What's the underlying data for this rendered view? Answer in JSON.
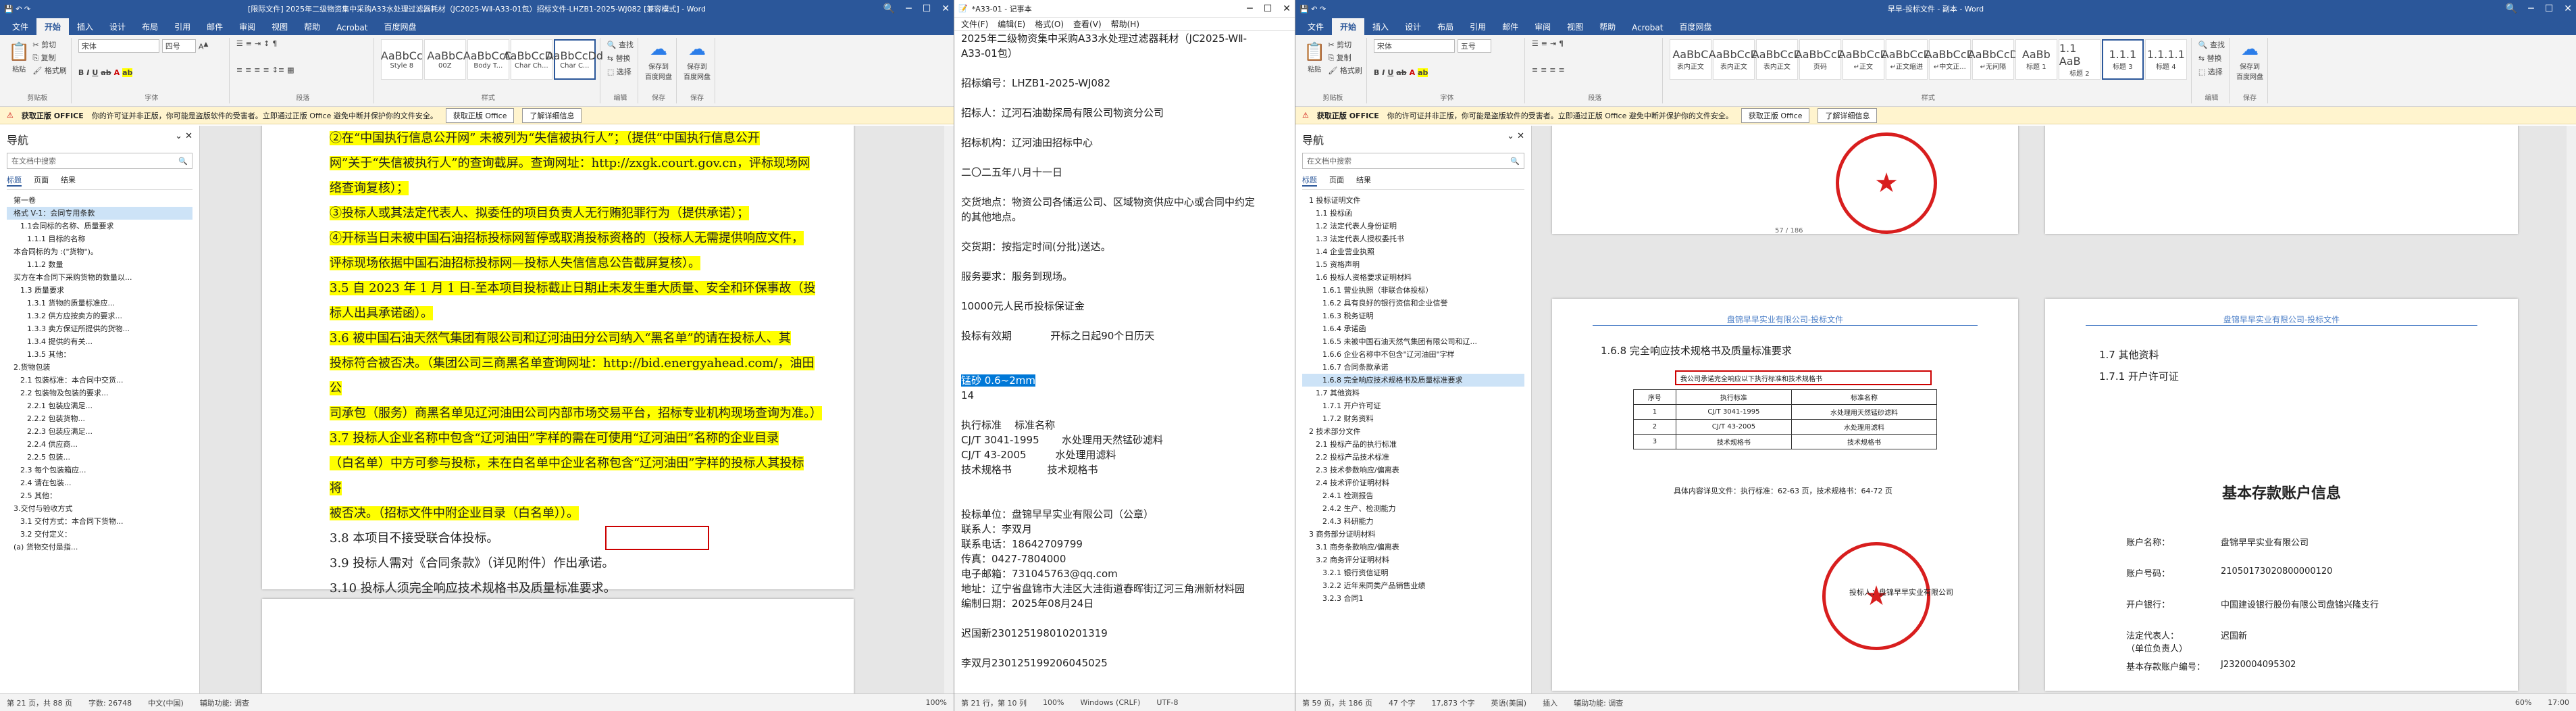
{
  "win1": {
    "title": "[限际文件] 2025年二级物资集中采购A33水处理过滤器耗材（JC2025-WⅡ-A33-01包）招标文件-LHZB1-2025-WJ082 [兼容模式] - Word",
    "tabs": [
      "文件",
      "开始",
      "插入",
      "设计",
      "布局",
      "引用",
      "邮件",
      "审阅",
      "视图",
      "帮助",
      "Acrobat",
      "百度网盘"
    ],
    "active_tab": "开始",
    "font_name": "宋体",
    "font_size": "四号",
    "styles": [
      {
        "preview": "AaBbCc",
        "name": "Style 8"
      },
      {
        "preview": "AaBbC",
        "name": "00Z"
      },
      {
        "preview": "AaBbCcD",
        "name": "Body T..."
      },
      {
        "preview": "AaBbCcDd",
        "name": "Char Ch..."
      },
      {
        "preview": "AaBbCcDd",
        "name": "Char C..."
      }
    ],
    "groups": [
      "剪贴板",
      "字体",
      "段落",
      "样式",
      "编辑",
      "保存",
      "保存"
    ],
    "clipboard": {
      "paste": "粘贴",
      "cut": "剪切",
      "copy": "复制",
      "format": "格式刷"
    },
    "edit": {
      "find": "查找",
      "replace": "替换",
      "select": "选择"
    },
    "save_button": "保存到\n百度网盘",
    "msg": {
      "label": "获取正版 OFFICE",
      "text": "你的许可证并非正版，你可能是盗版软件的受害者。立即通过正版 Office 避免中断并保护你的文件安全。",
      "b1": "获取正版 Office",
      "b2": "了解详细信息"
    },
    "nav": {
      "title": "导航",
      "search_placeholder": "在文档中搜索",
      "tabs": [
        "标题",
        "页面",
        "结果"
      ],
      "items": [
        "第一卷",
        "格式 V-1：会同专用条款",
        "1.1会同标的名称、质量要求",
        "1.1.1 目标的名称",
        "本合同标的为 :(\"货物\")。",
        "1.1.2 数量",
        "买方在本合同下采购货物的数量以...",
        "1.3 质量要求",
        "1.3.1 货物的质量标准应...",
        "1.3.2 供方应按卖方的要求...",
        "1.3.3 卖方保证所提供的货物...",
        "1.3.4 提供的有关...",
        "1.3.5 其他：",
        "2.货物包装",
        "2.1 包装标准：本合同中交货...",
        "2.2 包装物及包装的要求...",
        "2.2.1 包装应满足...",
        "2.2.2 包装货物...",
        "2.2.3 包装应满足...",
        "2.2.4 供应商...",
        "2.2.5 包装...",
        "2.3 每个包装箱应...",
        "2.4 请在包装...",
        "2.5 其他：",
        "3.交付与验收方式",
        "3.1 交付方式：本合同下货物...",
        "3.2 交付定义：",
        "(a) 货物交付是指..."
      ]
    },
    "doc_lines": [
      {
        "text": "②在“中国执行信息公开网” 未被列为“失信被执行人”；（提供“中国执行信息公开",
        "hl": true
      },
      {
        "text": "网”关于“失信被执行人”的查询截屏。查询网址：http://zxgk.court.gov.cn，评标现场网",
        "hl": true
      },
      {
        "text": "络查询复核）；",
        "hl": true
      },
      {
        "text": "    ③投标人或其法定代表人、拟委任的项目负责人无行贿犯罪行为（提供承诺）；",
        "hl": true
      },
      {
        "text": "    ④开标当日未被中国石油招标投标网暂停或取消投标资格的（投标人无需提供响应文件，",
        "hl": true
      },
      {
        "text": "评标现场依据中国石油招标投标网—投标人失信信息公告截屏复核）。",
        "hl": true
      },
      {
        "text": "    3.5 自 2023 年 1 月 1 日-至本项目投标截止日期止未发生重大质量、安全和环保事故（投",
        "hl": true
      },
      {
        "text": "标人出具承诺函）。",
        "hl": true
      },
      {
        "text": "    3.6 被中国石油天然气集团有限公司和辽河油田分公司纳入“黑名单”的请在投标人、其",
        "hl": true
      },
      {
        "text": "投标符合被否决。（集团公司三商黑名单查询网址：http://bid.energyahead.com/，油田公",
        "hl": true
      },
      {
        "text": "司承包（服务）商黑名单见辽河油田公司内部市场交易平台，招标专业机构现场查询为准。）",
        "hl": true
      },
      {
        "text": "    3.7 投标人企业名称中包含“辽河油田”字样的需在可使用“辽河油田”名称的企业目录",
        "hl": true
      },
      {
        "text": "（白名单）中方可参与投标，未在白名单中企业名称包含“辽河油田”字样的投标人其投标将",
        "hl": true
      },
      {
        "text": "被否决。（招标文件中附企业目录（白名单））。",
        "hl": true
      },
      {
        "text": "    3.8 本项目不接受联合体投标。",
        "hl": false
      },
      {
        "text": "    3.9 投标人需对《合同条款》（详见附件）作出承诺。",
        "hl": false
      },
      {
        "text": "    3.10 投标人须完全响应技术规格书及质量标准要求。",
        "hl": false
      }
    ],
    "doc_redbox_text": "及质量标准要求。",
    "status": {
      "page": "第 21 页，共 88 页",
      "words": "字数: 26748",
      "lang": "中文(中国)",
      "a11y": "辅助功能: 调查",
      "zoom": "100%"
    }
  },
  "win2": {
    "title": "*A33-01 - 记事本",
    "menu": [
      "文件(F)",
      "编辑(E)",
      "格式(O)",
      "查看(V)",
      "帮助(H)"
    ],
    "lines": [
      "2025年二级物资集中采购A33水处理过滤器耗材（JC2025-WⅡ-",
      "A33-01包）",
      "",
      "招标编号：LHZB1-2025-WJ082",
      "",
      "招标人：辽河石油勘探局有限公司物资分公司",
      "",
      "招标机构：辽河油田招标中心",
      "",
      "二〇二五年八月十一日",
      "",
      "交货地点：物资公司各储运公司、区域物资供应中心或合同中约定",
      "的其他地点。",
      "",
      "交货期：按指定时间(分批)送达。",
      "",
      "服务要求：服务到现场。",
      "",
      "10000元人民币投标保证金",
      "",
      "投标有效期            开标之日起90个日历天",
      "",
      "",
      "__SEL__",
      "14",
      "",
      "执行标准    标准名称",
      "CJ/T 3041-1995       水处理用天然锰砂滤料",
      "CJ/T 43-2005         水处理用滤料",
      "技术规格书           技术规格书",
      "",
      "",
      "投标单位：盘锦早早实业有限公司（公章）",
      "联系人：李双月",
      "联系电话：18642709799",
      "传真：0427-7804000",
      "电子邮箱：731045763@qq.com",
      "地址：辽宁省盘锦市大洼区大洼街道春晖街辽河三角洲新材料园",
      "编制日期：2025年08月24日",
      "",
      "迟国新230125198010201319",
      "",
      "李双月230125199206045025"
    ],
    "selected_text": "锰砂 0.6~2mm",
    "status": {
      "pos": "第 21 行，第 10 列",
      "zoom": "100%",
      "eol": "Windows (CRLF)",
      "enc": "UTF-8"
    }
  },
  "win3": {
    "title": "早早-投标文件 - 副本 - Word",
    "tabs": [
      "文件",
      "开始",
      "插入",
      "设计",
      "布局",
      "引用",
      "邮件",
      "审阅",
      "视图",
      "帮助",
      "Acrobat",
      "百度网盘"
    ],
    "active_tab": "开始",
    "font_name": "宋体",
    "font_size": "五号",
    "styles": [
      {
        "preview": "AaBbC",
        "name": "表内正文"
      },
      {
        "preview": "AaBbCcD",
        "name": "表内正文"
      },
      {
        "preview": "AaBbCcD",
        "name": "表内正文"
      },
      {
        "preview": "AaBbCcD",
        "name": "页码"
      },
      {
        "preview": "AaBbCcD",
        "name": "↵正文"
      },
      {
        "preview": "AaBbCcD",
        "name": "↵正文缩进"
      },
      {
        "preview": "AaBbCcD",
        "name": "↵中文正..."
      },
      {
        "preview": "AaBbCcD",
        "name": "↵无间隔"
      },
      {
        "preview": "AaBb",
        "name": "标题 1"
      },
      {
        "preview": "1.1 AaB",
        "name": "标题 2"
      },
      {
        "preview": "1.1.1",
        "name": "标题 3"
      },
      {
        "preview": "1.1.1.1",
        "name": "标题 4"
      }
    ],
    "nav": {
      "title": "导航",
      "search_placeholder": "在文档中搜索",
      "tabs": [
        "标题",
        "页面",
        "结果"
      ],
      "items": [
        "1 投标证明文件",
        "1.1 投标函",
        "1.2 法定代表人身份证明",
        "1.3 法定代表人授权委托书",
        "1.4 企业营业执照",
        "1.5 资格声明",
        "1.6 投标人资格要求证明材料",
        "1.6.1 营业执照（非联合体投标）",
        "1.6.2 具有良好的银行资信和企业信誉",
        "1.6.3 税务证明",
        "1.6.4 承诺函",
        "1.6.5 未被中国石油天然气集团有限公司和辽...",
        "1.6.6 企业名称中不包含\"辽河油田\"字样",
        "1.6.7 合同条款承诺",
        "1.6.8 完全响应技术规格书及质量标准要求",
        "1.7 其他资料",
        "1.7.1 开户许可证",
        "1.7.2 财务资料",
        "2 技术部分文件",
        "2.1 投标产品的执行标准",
        "2.2 投标产品技术标准",
        "2.3 技术参数响应/偏离表",
        "2.4 技术评价证明材料",
        "2.4.1 检测报告",
        "2.4.2 生产、检测能力",
        "2.4.3 科研能力",
        "3 商务部分证明材料",
        "3.1 商务条款响应/偏离表",
        "3.2 商务评分证明材料",
        "3.2.1 银行资信证明",
        "3.2.2 近年来同类产品销售业绩",
        "3.2.3 合同1"
      ]
    },
    "page_hdr": "盘锦早早实业有限公司-投标文件",
    "heading_168": "1.6.8  完全响应技术规格书及质量标准要求",
    "redbox_text": "我公司承诺完全响应以下执行标准和技术规格书",
    "table": [
      [
        "序号",
        "执行标准",
        "标准名称"
      ],
      [
        "1",
        "CJ/T 3041-1995",
        "水处理用天然锰砂滤料"
      ],
      [
        "2",
        "CJ/T 43-2005",
        "水处理用滤料"
      ],
      [
        "3",
        "技术规格书",
        "技术规格书"
      ]
    ],
    "detail_note": "具体内容详见文件：执行标准：62-63 页，技术规格书：64-72 页",
    "sign_text": "投标人：盘锦早早实业有限公司",
    "seal_company": "盘锦早早实业有限公司",
    "heading_17": "1.7    其他资料",
    "heading_171": "1.7.1  开户许可证",
    "acct_title": "基本存款账户信息",
    "acct": [
      {
        "k": "账户名称：",
        "v": "盘锦早早实业有限公司"
      },
      {
        "k": "账户号码：",
        "v": "21050173020800000120"
      },
      {
        "k": "开户银行：",
        "v": "中国建设银行股份有限公司盘锦兴隆支行"
      },
      {
        "k": "法定代表人：\n（单位负责人）",
        "v": "迟国新"
      },
      {
        "k": "基本存款账户编号：",
        "v": "J2320004095302"
      }
    ],
    "page_num": "57 / 186",
    "status": {
      "page": "第 59 页，共 186 页",
      "words": "47 个字",
      "words2": "17,873 个字",
      "lang": "英语(美国)",
      "mode": "插入",
      "a11y": "辅助功能: 调查",
      "zoom": "60%"
    }
  },
  "taskbar_time": "17:00"
}
